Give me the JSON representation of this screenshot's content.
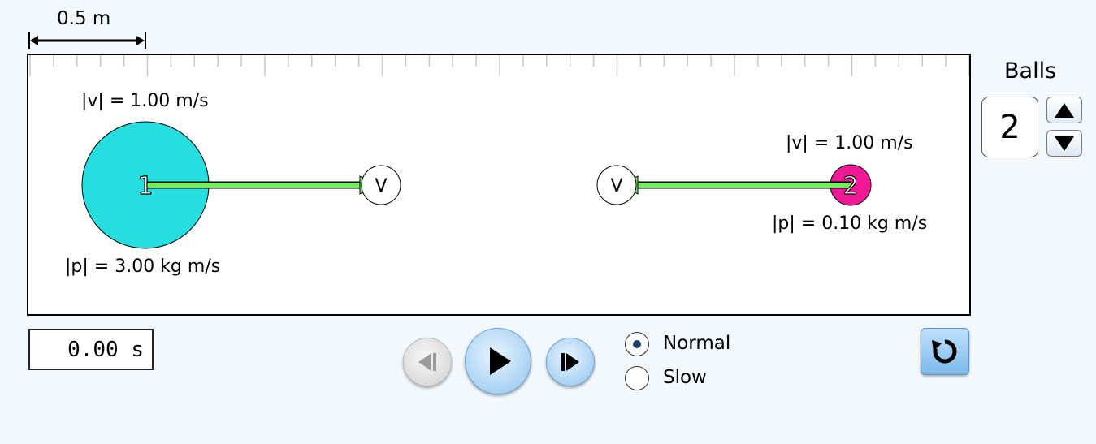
{
  "scale": {
    "label": "0.5 m"
  },
  "balls": [
    {
      "id": "1",
      "velocity_label": "|v| = 1.00 m/s",
      "momentum_label": "|p| = 3.00 kg m/s",
      "color": "#26dedf",
      "vector_tag": "V"
    },
    {
      "id": "2",
      "velocity_label": "|v| = 1.00 m/s",
      "momentum_label": "|p| = 0.10 kg m/s",
      "color": "#ef1896",
      "vector_tag": "V"
    }
  ],
  "vector_color": "#6df05a",
  "balls_panel": {
    "title": "Balls",
    "count": "2"
  },
  "time": {
    "readout": "0.00 s"
  },
  "speed": {
    "options": [
      "Normal",
      "Slow"
    ],
    "selected": "Normal"
  },
  "icons": {
    "step_back": "step-back-icon",
    "play": "play-icon",
    "step_forward": "step-forward-icon",
    "reset": "reset-icon",
    "up": "arrow-up-icon",
    "down": "arrow-down-icon"
  }
}
